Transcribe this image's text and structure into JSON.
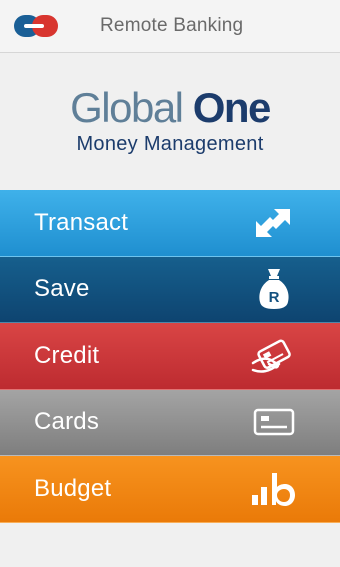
{
  "header": {
    "title": "Remote Banking",
    "logo_icon": "capitec-logo-icon"
  },
  "brand": {
    "name_part1": "Global",
    "name_part2": "One",
    "subtitle": "Money Management",
    "colors": {
      "light": "#5f7f98",
      "dark": "#1c3c6c"
    }
  },
  "menu": {
    "items": [
      {
        "label": "Transact",
        "icon": "transfer-arrows-icon",
        "color": "#2fa2e0"
      },
      {
        "label": "Save",
        "icon": "money-bag-icon",
        "color": "#13517f"
      },
      {
        "label": "Credit",
        "icon": "credit-card-hand-icon",
        "color": "#cc3838"
      },
      {
        "label": "Cards",
        "icon": "card-icon",
        "color": "#919191"
      },
      {
        "label": "Budget",
        "icon": "budget-bars-icon",
        "color": "#f08612"
      }
    ]
  }
}
